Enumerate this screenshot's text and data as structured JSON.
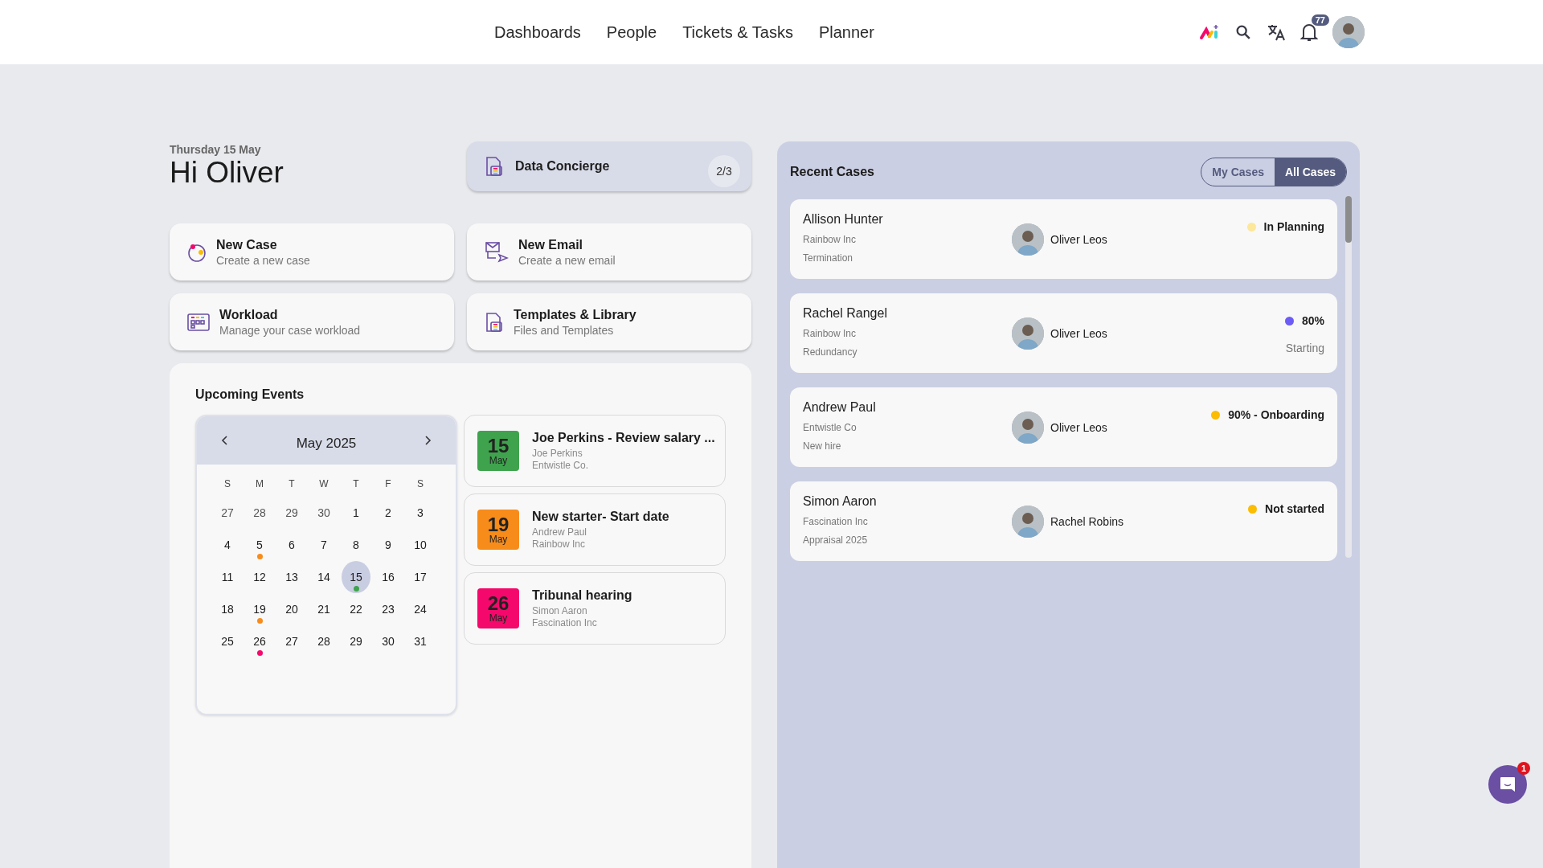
{
  "nav": {
    "links": [
      {
        "label": "Dashboards"
      },
      {
        "label": "People"
      },
      {
        "label": "Tickets & Tasks"
      },
      {
        "label": "Planner"
      }
    ],
    "notifications": "77"
  },
  "greeting": {
    "date": "Thursday 15 May",
    "title": "Hi Oliver"
  },
  "concierge": {
    "title": "Data Concierge",
    "count": "2/3"
  },
  "actions": [
    {
      "kind": "case",
      "title": "New Case",
      "subtitle": "Create a new case"
    },
    {
      "kind": "email",
      "title": "New Email",
      "subtitle": "Create a new email"
    },
    {
      "kind": "workload",
      "title": "Workload",
      "subtitle": "Manage your case workload"
    },
    {
      "kind": "templates",
      "title": "Templates & Library",
      "subtitle": "Files and Templates"
    }
  ],
  "events": {
    "title": "Upcoming Events",
    "calendar": {
      "month": "May 2025",
      "weekdays": [
        "S",
        "M",
        "T",
        "W",
        "T",
        "F",
        "S"
      ],
      "weeks": [
        [
          {
            "day": "27",
            "outside": true,
            "selected": false
          },
          {
            "day": "28",
            "outside": true,
            "selected": false
          },
          {
            "day": "29",
            "outside": true,
            "selected": false
          },
          {
            "day": "30",
            "outside": true,
            "selected": false
          },
          {
            "day": "1",
            "outside": false,
            "selected": false
          },
          {
            "day": "2",
            "outside": false,
            "selected": false
          },
          {
            "day": "3",
            "outside": false,
            "selected": false
          }
        ],
        [
          {
            "day": "4",
            "outside": false,
            "selected": false
          },
          {
            "day": "5",
            "outside": false,
            "selected": false,
            "color": "#f78c1b"
          },
          {
            "day": "6",
            "outside": false,
            "selected": false
          },
          {
            "day": "7",
            "outside": false,
            "selected": false
          },
          {
            "day": "8",
            "outside": false,
            "selected": false
          },
          {
            "day": "9",
            "outside": false,
            "selected": false
          },
          {
            "day": "10",
            "outside": false,
            "selected": false
          }
        ],
        [
          {
            "day": "11",
            "outside": false,
            "selected": false
          },
          {
            "day": "12",
            "outside": false,
            "selected": false
          },
          {
            "day": "13",
            "outside": false,
            "selected": false
          },
          {
            "day": "14",
            "outside": false,
            "selected": false
          },
          {
            "day": "15",
            "outside": false,
            "selected": true,
            "color": "#3fa34d"
          },
          {
            "day": "16",
            "outside": false,
            "selected": false
          },
          {
            "day": "17",
            "outside": false,
            "selected": false
          }
        ],
        [
          {
            "day": "18",
            "outside": false,
            "selected": false
          },
          {
            "day": "19",
            "outside": false,
            "selected": false,
            "color": "#f78c1b"
          },
          {
            "day": "20",
            "outside": false,
            "selected": false
          },
          {
            "day": "21",
            "outside": false,
            "selected": false
          },
          {
            "day": "22",
            "outside": false,
            "selected": false
          },
          {
            "day": "23",
            "outside": false,
            "selected": false
          },
          {
            "day": "24",
            "outside": false,
            "selected": false
          }
        ],
        [
          {
            "day": "25",
            "outside": false,
            "selected": false
          },
          {
            "day": "26",
            "outside": false,
            "selected": false,
            "color": "#f5086b"
          },
          {
            "day": "27",
            "outside": false,
            "selected": false
          },
          {
            "day": "28",
            "outside": false,
            "selected": false
          },
          {
            "day": "29",
            "outside": false,
            "selected": false
          },
          {
            "day": "30",
            "outside": false,
            "selected": false
          },
          {
            "day": "31",
            "outside": false,
            "selected": false
          }
        ]
      ]
    },
    "items": [
      {
        "day": "15",
        "month": "May",
        "color": "#3fa34d",
        "title": "Joe Perkins - Review salary ...",
        "person": "Joe Perkins",
        "company": "Entwistle Co."
      },
      {
        "day": "19",
        "month": "May",
        "color": "#f78c1b",
        "title": "New starter- Start date",
        "person": "Andrew Paul",
        "company": "Rainbow Inc"
      },
      {
        "day": "26",
        "month": "May",
        "color": "#f5086b",
        "title": "Tribunal hearing",
        "person": "Simon Aaron",
        "company": "Fascination Inc"
      }
    ]
  },
  "recent_cases": {
    "title": "Recent Cases",
    "filters": [
      {
        "label": "My Cases",
        "selected": false
      },
      {
        "label": "All Cases",
        "selected": true
      }
    ],
    "cases": [
      {
        "name": "Allison Hunter",
        "company": "Rainbow Inc",
        "type": "Termination",
        "owner": "Oliver Leos",
        "status": "In Planning",
        "color": "#fde79a"
      },
      {
        "name": "Rachel Rangel",
        "company": "Rainbow Inc",
        "type": "Redundancy",
        "owner": "Oliver Leos",
        "status": "80%",
        "stage": "Starting",
        "color": "#6c5cf5"
      },
      {
        "name": "Andrew Paul",
        "company": "Entwistle Co",
        "type": "New hire",
        "owner": "Oliver Leos",
        "status": "90% - Onboarding",
        "color": "#fbbc04"
      },
      {
        "name": "Simon Aaron",
        "company": "Fascination Inc",
        "type": "Appraisal 2025",
        "owner": "Rachel Robins",
        "status": "Not started",
        "color": "#fbbc04"
      }
    ]
  },
  "chat": {
    "badge": "1"
  }
}
